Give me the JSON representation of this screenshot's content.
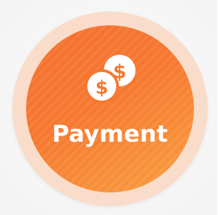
{
  "badge": {
    "label": "Payment",
    "icon": "coins-dollar-icon",
    "currency_symbol": "$",
    "colors": {
      "badge_start": "#f56f2e",
      "badge_end": "#fa9f42",
      "ring": "#f9dcc9",
      "foreground": "#ffffff"
    }
  }
}
